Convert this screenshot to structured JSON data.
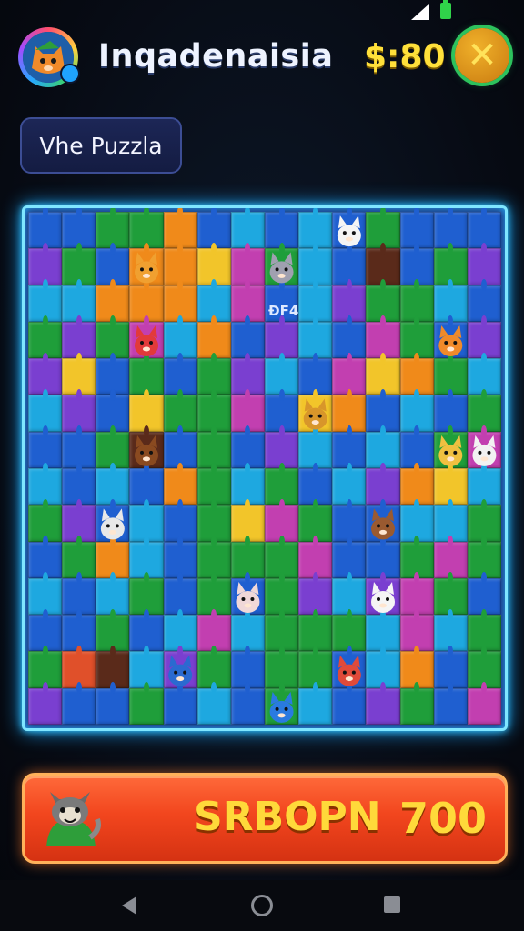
{
  "header": {
    "title": "Inqadenaisia",
    "money": "$:80"
  },
  "mode_label": "Vhe Puzzla",
  "board": {
    "columns": 14,
    "rows": 14,
    "overlay_text": "ÐF4",
    "palette": {
      "g": "#1f9e3a",
      "b": "#1f5fd0",
      "c": "#1ea8e0",
      "o": "#f08a1a",
      "y": "#f2c52a",
      "p": "#7a3fd0",
      "m": "#c23fb0",
      "r": "#e0502a",
      "d": "#5a2a1a",
      "l": "#4fd06a"
    },
    "tiles": [
      "bbggobcbcbgbbb",
      "pgbooymgcbdbgp",
      "ccooocmbcpggcb",
      "gpgmcobpcbmgbp",
      "pybgbgpcbmyogc",
      "cpbyggmbyobcbg",
      "bbgdbgbpcbcbgm",
      "cbcbogcgbcpoyc",
      "gpbcbgymgbbccg",
      "bgocbgggmbbgmg",
      "cbcgbgbgpcpmgb",
      "bbgbcmcgggcmcg",
      "grdcpgbggbcobg",
      "pbbgbcbgcbpgbm"
    ],
    "characters": [
      {
        "name": "fox-creature",
        "color": "#f0a030",
        "col": 3,
        "row": 1
      },
      {
        "name": "cat-creature",
        "color": "#f4f4f4",
        "col": 9,
        "row": 0
      },
      {
        "name": "mouse-creature",
        "color": "#a0a0b0",
        "col": 7,
        "row": 1
      },
      {
        "name": "gnome-creature",
        "color": "#e23a3a",
        "col": 3,
        "row": 3
      },
      {
        "name": "fox-creature-2",
        "color": "#f08a2a",
        "col": 12,
        "row": 3
      },
      {
        "name": "dog-creature",
        "color": "#d8962a",
        "col": 8,
        "row": 5
      },
      {
        "name": "cat-creature-2",
        "color": "#f2f2f2",
        "col": 13,
        "row": 6
      },
      {
        "name": "cat-creature-3",
        "color": "#f0c040",
        "col": 12,
        "row": 6
      },
      {
        "name": "bear-creature",
        "color": "#8a4a20",
        "col": 3,
        "row": 6
      },
      {
        "name": "cat-creature-4",
        "color": "#e8e8e8",
        "col": 2,
        "row": 8
      },
      {
        "name": "bear-creature-2",
        "color": "#9a5a30",
        "col": 10,
        "row": 8
      },
      {
        "name": "cat-creature-5",
        "color": "#f5f5f5",
        "col": 10,
        "row": 10
      },
      {
        "name": "cat-creature-6",
        "color": "#f0d8d8",
        "col": 6,
        "row": 10
      },
      {
        "name": "gnome-creature-2",
        "color": "#2a6ad0",
        "col": 4,
        "row": 12
      },
      {
        "name": "gnome-creature-3",
        "color": "#e04a3a",
        "col": 9,
        "row": 12
      },
      {
        "name": "penguin-creature",
        "color": "#2a7ae0",
        "col": 7,
        "row": 13
      }
    ]
  },
  "action_button": {
    "label": "SRBOPN",
    "value": "700"
  },
  "colors": {
    "accent_green": "#2dc25d",
    "gold": "#ffd93a",
    "board_glow": "#36c8ff",
    "button_orange": "#f2461e"
  },
  "icons": [
    "signal-icon",
    "battery-icon",
    "avatar-fox-icon",
    "close-icon",
    "back-nav-icon",
    "home-nav-icon",
    "recents-nav-icon"
  ]
}
